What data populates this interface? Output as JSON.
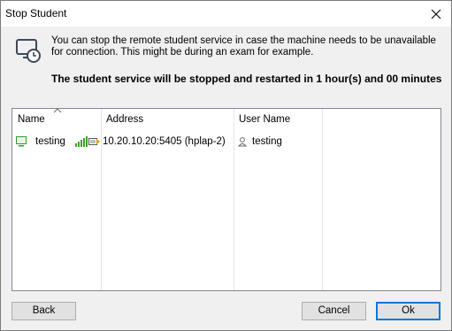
{
  "window": {
    "title": "Stop Student"
  },
  "info": {
    "description": "You can stop the remote student service in case the machine needs to be unavailable for connection. This might be during an exam for example.",
    "schedule": "The student service will be stopped and restarted in 1 hour(s) and 00 minutes"
  },
  "list": {
    "columns": {
      "name": "Name",
      "address": "Address",
      "user": "User Name"
    },
    "rows": [
      {
        "name": "testing",
        "address": "10.20.10.20:5405 (hplap-2)",
        "user": "testing"
      }
    ]
  },
  "buttons": {
    "back": "Back",
    "cancel": "Cancel",
    "ok": "Ok"
  },
  "colors": {
    "accent": "#0078d7",
    "signal": "#3aa321",
    "device_icon": "#2e9e2e"
  }
}
